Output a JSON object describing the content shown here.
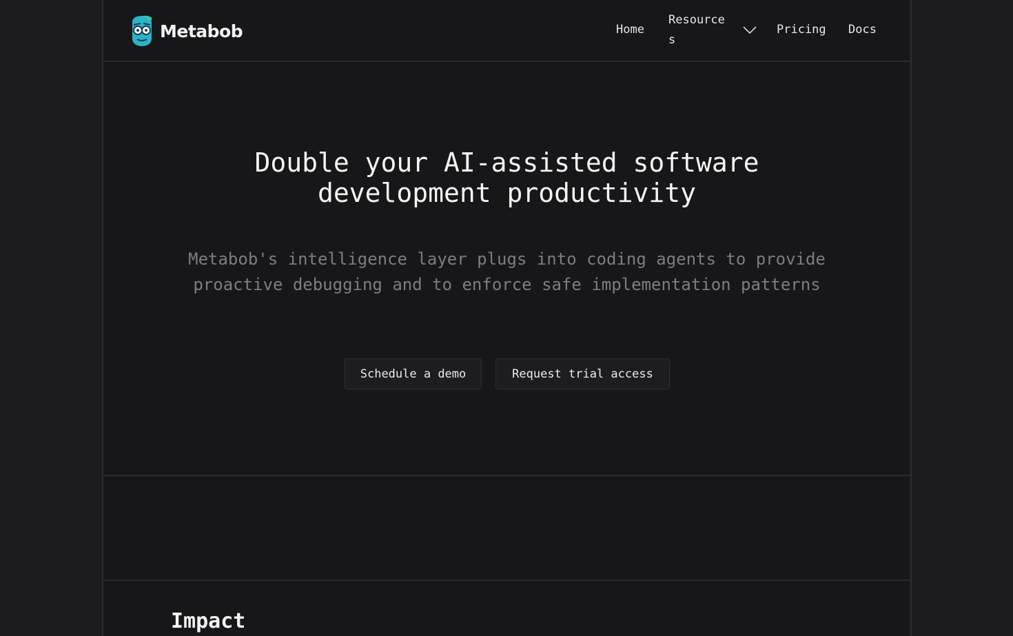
{
  "header": {
    "brand": "Metabob",
    "nav": {
      "home": "Home",
      "resources": "Resources",
      "pricing": "Pricing",
      "docs": "Docs"
    }
  },
  "hero": {
    "title_line1": "Double your AI-assisted software",
    "title_line2": "development productivity",
    "subtitle": "Metabob's intelligence layer plugs into coding agents to provide proactive debugging and to enforce safe implementation patterns",
    "primary_button": "Schedule a demo",
    "secondary_button": "Request trial access"
  },
  "sections": {
    "impact_heading": "Impact"
  },
  "colors": {
    "page_bg": "#1c1b1d",
    "frame_bg": "#171619",
    "border": "#2c2b2e",
    "muted_text": "#7e7c80",
    "logo_teal": "#2bb3c8"
  }
}
